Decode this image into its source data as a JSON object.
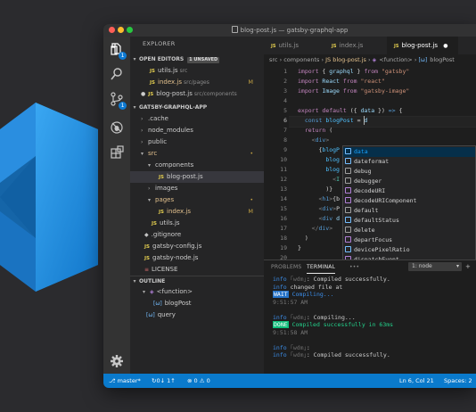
{
  "window": {
    "title": "blog-post.js — gatsby-graphql-app"
  },
  "activity_bar": {
    "explorer_badge": "1",
    "scm_badge": "1"
  },
  "explorer": {
    "title": "EXPLORER",
    "open_editors": {
      "header": "OPEN EDITORS",
      "unsaved_badge": "1 UNSAVED",
      "items": [
        {
          "icon": "JS",
          "name": "utils.js",
          "path": "src",
          "status": ""
        },
        {
          "icon": "JS",
          "name": "index.js",
          "path": "src/pages",
          "status": "M"
        },
        {
          "icon": "JS",
          "name": "blog-post.js",
          "path": "src/components",
          "status": ""
        }
      ]
    },
    "project": {
      "header": "GATSBY-GRAPHQL-APP",
      "items": [
        {
          "label": ".cache",
          "status": ""
        },
        {
          "label": "node_modules",
          "status": ""
        },
        {
          "label": "public",
          "status": ""
        },
        {
          "label": "src",
          "status": "•"
        },
        {
          "label": "components",
          "status": ""
        },
        {
          "icon": "JS",
          "label": "blog-post.js",
          "status": ""
        },
        {
          "label": "images",
          "status": ""
        },
        {
          "label": "pages",
          "status": "•"
        },
        {
          "icon": "JS",
          "label": "index.js",
          "status": "M"
        },
        {
          "icon": "JS",
          "label": "utils.js",
          "status": ""
        },
        {
          "label": ".gitignore",
          "status": ""
        },
        {
          "icon": "JS",
          "label": "gatsby-config.js",
          "status": ""
        },
        {
          "icon": "JS",
          "label": "gatsby-node.js",
          "status": ""
        },
        {
          "label": "LICENSE",
          "status": ""
        }
      ]
    },
    "outline": {
      "header": "OUTLINE",
      "items": [
        "<function>",
        "blogPost",
        "query"
      ]
    }
  },
  "editor": {
    "tabs": [
      {
        "icon": "JS",
        "label": "utils.js"
      },
      {
        "icon": "JS",
        "label": "index.js"
      },
      {
        "icon": "JS",
        "label": "blog-post.js",
        "marker": "●"
      }
    ],
    "breadcrumb": [
      "src",
      "components",
      "JS blog-post.js",
      "<function>",
      "blogPost"
    ],
    "code_lines": [
      {
        "n": "1",
        "text": "import { graphql } from \"gatsby\""
      },
      {
        "n": "2",
        "text": "import React from \"react\""
      },
      {
        "n": "3",
        "text": "import Image from \"gatsby-image\""
      },
      {
        "n": "4",
        "text": ""
      },
      {
        "n": "5",
        "text": "export default ({ data }) => {"
      },
      {
        "n": "6",
        "text": "  const blogPost = d"
      },
      {
        "n": "7",
        "text": "  return ("
      },
      {
        "n": "8",
        "text": "    <div>"
      },
      {
        "n": "9",
        "text": "      {blogP"
      },
      {
        "n": "10",
        "text": "        blog"
      },
      {
        "n": "11",
        "text": "        blog"
      },
      {
        "n": "12",
        "text": "          <I"
      },
      {
        "n": "13",
        "text": "        )}"
      },
      {
        "n": "14",
        "text": "      <h1>{b"
      },
      {
        "n": "15",
        "text": "      <div>P"
      },
      {
        "n": "16",
        "text": "      <div d"
      },
      {
        "n": "17",
        "text": "    </div>"
      },
      {
        "n": "18",
        "text": "  )"
      },
      {
        "n": "19",
        "text": "}"
      },
      {
        "n": "20",
        "text": ""
      }
    ],
    "suggestions": [
      "data",
      "dateformat",
      "debug",
      "debugger",
      "decodeURI",
      "decodeURIComponent",
      "default",
      "defaultStatus",
      "delete",
      "departFocus",
      "devicePixelRatio",
      "dispatchEvent"
    ]
  },
  "panel": {
    "tabs": [
      "PROBLEMS",
      "TERMINAL",
      "•••"
    ],
    "terminal_select": "1: node",
    "terminal_lines": [
      "info ｢wdm｣: Compiled successfully.",
      "info changed file at",
      "WAIT Compiling...",
      "9:51:57 AM",
      "",
      "info ｢wdm｣: Compiling...",
      "DONE Compiled successfully in 63ms",
      "9:51:58 AM",
      "",
      "info ｢wdm｣:",
      "info ｢wdm｣: Compiled successfully."
    ]
  },
  "statusbar": {
    "branch": "master*",
    "sync": "0↓ 1↑",
    "problems": "0",
    "warnings": "0",
    "position": "Ln 6, Col 21",
    "spaces": "Spaces: 2"
  },
  "colors": {
    "accent": "#0a7acc",
    "background": "#2b2b2e",
    "editor_bg": "#1e1e1e",
    "logo_blue": "#1f9cf0"
  }
}
